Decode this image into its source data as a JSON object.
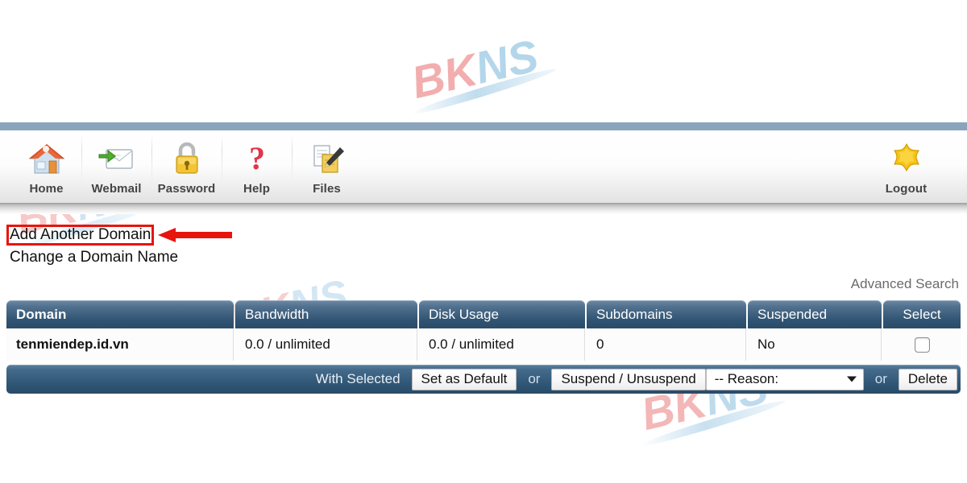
{
  "toolbar": {
    "items": [
      {
        "label": "Home",
        "icon": "house-icon"
      },
      {
        "label": "Webmail",
        "icon": "envelope-arrow-icon"
      },
      {
        "label": "Password",
        "icon": "padlock-icon"
      },
      {
        "label": "Help",
        "icon": "question-mark-icon"
      },
      {
        "label": "Files",
        "icon": "documents-pencil-icon"
      }
    ],
    "logout": {
      "label": "Logout",
      "icon": "star-icon"
    }
  },
  "links": {
    "add_domain": "Add Another Domain",
    "change_domain": "Change a Domain Name"
  },
  "annotation": {
    "highlight_color": "#e8140e",
    "arrow_color": "#e8140e"
  },
  "advanced_search": "Advanced Search",
  "table": {
    "headers": [
      "Domain",
      "Bandwidth",
      "Disk Usage",
      "Subdomains",
      "Suspended",
      "Select"
    ],
    "rows": [
      {
        "domain": "tenmiendep.id.vn",
        "bandwidth": "0.0 / unlimited",
        "disk_usage": "0.0 / unlimited",
        "subdomains": "0",
        "suspended": "No",
        "selected": false
      }
    ]
  },
  "action_bar": {
    "with_selected_label": "With Selected",
    "set_default_button": "Set as Default",
    "or_1": "or",
    "suspend_button": "Suspend / Unsuspend",
    "reason_select": "-- Reason:",
    "or_2": "or",
    "delete_button": "Delete"
  },
  "watermark": {
    "part1": "BK",
    "part2": "NS",
    "color1": "#f0a0a0",
    "color2": "#a8cfe8"
  }
}
